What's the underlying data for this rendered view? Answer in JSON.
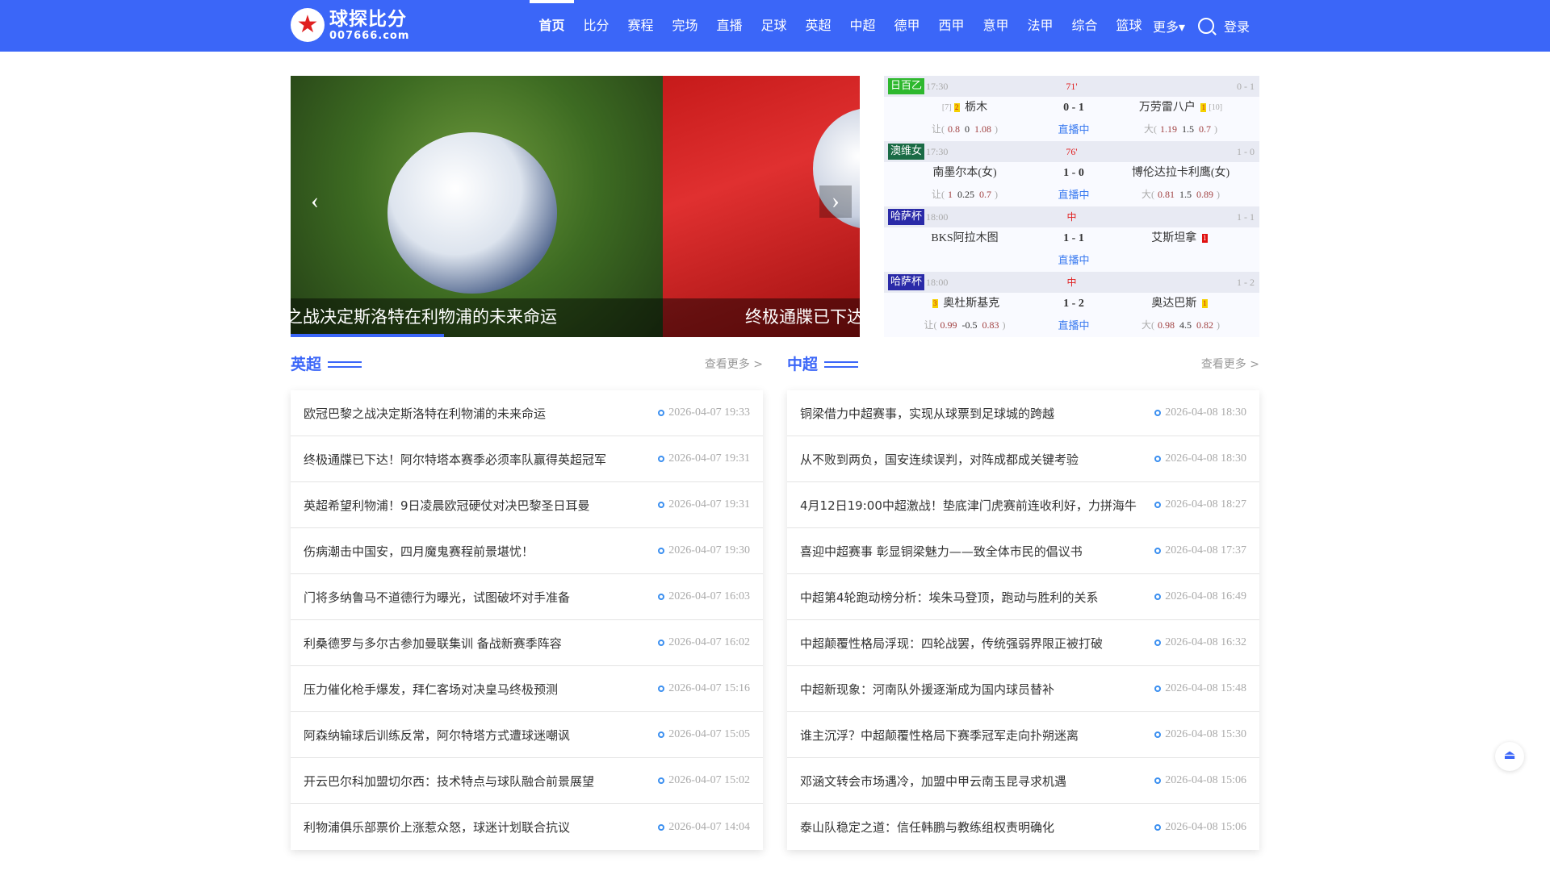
{
  "header": {
    "logo_name": "球探比分",
    "logo_url": "007666.com",
    "nav": [
      "首页",
      "比分",
      "赛程",
      "完场",
      "直播",
      "足球",
      "英超",
      "中超",
      "德甲",
      "西甲",
      "意甲",
      "法甲",
      "综合",
      "篮球"
    ],
    "more": "更多▾",
    "login": "登录"
  },
  "banner": {
    "captions": [
      "之战决定斯洛特在利物浦的未来命运",
      "终极通牒已下达"
    ]
  },
  "matches": [
    {
      "league": "日百乙",
      "league_color": "#2eb82e",
      "time": "17:30",
      "minute": "71'",
      "half": "0 - 1",
      "home_rank": "[7]",
      "home_card": "2",
      "home": "栃木",
      "score": "0 - 1",
      "away": "万劳雷八户",
      "away_card": "1",
      "away_rank": "[10]",
      "live": "直播中",
      "h_label": "让(",
      "h1": "0.8",
      "h2": "0",
      "h3": "1.08",
      "o_label": "大(",
      "o1": "1.19",
      "o2": "1.5",
      "o3": "0.7",
      "close": ")"
    },
    {
      "league": "澳维女",
      "league_color": "#1a6b45",
      "time": "17:30",
      "minute": "76'",
      "half": "1 - 0",
      "home": "南墨尔本(女)",
      "score": "1 - 0",
      "away": "博伦达拉卡利鹰(女)",
      "live": "直播中",
      "h_label": "让(",
      "h1": "1",
      "h2": "0.25",
      "h3": "0.7",
      "o_label": "大(",
      "o1": "0.81",
      "o2": "1.5",
      "o3": "0.89",
      "close": ")"
    },
    {
      "league": "哈萨杯",
      "league_color": "#2a2aa8",
      "time": "18:00",
      "minute": "中",
      "half": "1 - 1",
      "home": "BKS阿拉木图",
      "score": "1 - 1",
      "away": "艾斯坦拿",
      "away_card": "1",
      "live": "直播中"
    },
    {
      "league": "哈萨杯",
      "league_color": "#2a2aa8",
      "time": "18:00",
      "minute": "中",
      "half": "1 - 2",
      "home_card": "3",
      "home": "奥杜斯基克",
      "score": "1 - 2",
      "away": "奥达巴斯",
      "away_card": "1",
      "live": "直播中",
      "h_label": "让(",
      "h1": "0.99",
      "h2": "-0.5",
      "h3": "0.83",
      "o_label": "大(",
      "o1": "0.98",
      "o2": "4.5",
      "o3": "0.82",
      "close": ")"
    }
  ],
  "sections": [
    {
      "title": "英超",
      "more": "查看更多 >",
      "items": [
        {
          "title": "欧冠巴黎之战决定斯洛特在利物浦的未来命运",
          "date": "2026-04-07 19:33"
        },
        {
          "title": "终极通牒已下达！阿尔特塔本赛季必须率队赢得英超冠军",
          "date": "2026-04-07 19:31"
        },
        {
          "title": "英超希望利物浦！9日凌晨欧冠硬仗对决巴黎圣日耳曼",
          "date": "2026-04-07 19:31"
        },
        {
          "title": "伤病潮击中国安，四月魔鬼赛程前景堪忧！",
          "date": "2026-04-07 19:30"
        },
        {
          "title": "门将多纳鲁马不道德行为曝光，试图破坏对手准备",
          "date": "2026-04-07 16:03"
        },
        {
          "title": "利桑德罗与多尔古参加曼联集训 备战新赛季阵容",
          "date": "2026-04-07 16:02"
        },
        {
          "title": "压力催化枪手爆发，拜仁客场对决皇马终极预测",
          "date": "2026-04-07 15:16"
        },
        {
          "title": "阿森纳输球后训练反常，阿尔特塔方式遭球迷嘲讽",
          "date": "2026-04-07 15:05"
        },
        {
          "title": "开云巴尔科加盟切尔西：技术特点与球队融合前景展望",
          "date": "2026-04-07 15:02"
        },
        {
          "title": "利物浦俱乐部票价上涨惹众怒，球迷计划联合抗议",
          "date": "2026-04-07 14:04"
        }
      ]
    },
    {
      "title": "中超",
      "more": "查看更多 >",
      "items": [
        {
          "title": "铜梁借力中超赛事，实现从球票到足球城的跨越",
          "date": "2026-04-08 18:30"
        },
        {
          "title": "从不败到两负，国安连续误判，对阵成都成关键考验",
          "date": "2026-04-08 18:30"
        },
        {
          "title": "4月12日19:00中超激战！垫底津门虎赛前连收利好，力拼海牛",
          "date": "2026-04-08 18:27"
        },
        {
          "title": "喜迎中超赛事 彰显铜梁魅力——致全体市民的倡议书",
          "date": "2026-04-08 17:37"
        },
        {
          "title": "中超第4轮跑动榜分析：埃朱马登顶，跑动与胜利的关系",
          "date": "2026-04-08 16:49"
        },
        {
          "title": "中超颠覆性格局浮现：四轮战罢，传统强弱界限正被打破",
          "date": "2026-04-08 16:32"
        },
        {
          "title": "中超新现象：河南队外援逐渐成为国内球员替补",
          "date": "2026-04-08 15:48"
        },
        {
          "title": "谁主沉浮？中超颠覆性格局下赛季冠军走向扑朔迷离",
          "date": "2026-04-08 15:30"
        },
        {
          "title": "邓涵文转会市场遇冷，加盟中甲云南玉昆寻求机遇",
          "date": "2026-04-08 15:06"
        },
        {
          "title": "泰山队稳定之道：信任韩鹏与教练组权责明确化",
          "date": "2026-04-08 15:06"
        }
      ]
    }
  ]
}
